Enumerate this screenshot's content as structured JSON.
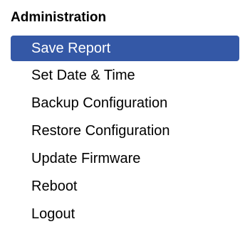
{
  "menu": {
    "heading": "Administration",
    "items": [
      {
        "label": "Save Report",
        "active": true
      },
      {
        "label": "Set Date & Time",
        "active": false
      },
      {
        "label": "Backup Configuration",
        "active": false
      },
      {
        "label": "Restore Configuration",
        "active": false
      },
      {
        "label": "Update Firmware",
        "active": false
      },
      {
        "label": "Reboot",
        "active": false
      },
      {
        "label": "Logout",
        "active": false
      }
    ]
  },
  "colors": {
    "active_background": "#3458a6",
    "active_text": "#ffffff",
    "text": "#000000",
    "page_background": "#ffffff"
  }
}
